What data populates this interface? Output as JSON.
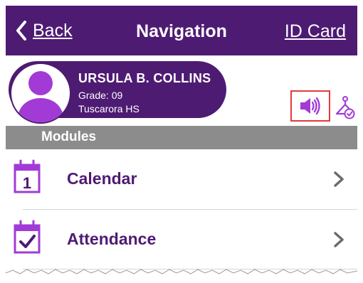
{
  "nav": {
    "back_label": "Back",
    "title": "Navigation",
    "id_card_label": "ID Card"
  },
  "student": {
    "name": "URSULA B. COLLINS",
    "grade_label": "Grade:",
    "grade_value": "09",
    "school": "Tuscarora HS"
  },
  "modules": {
    "header": "Modules",
    "items": [
      {
        "label": "Calendar",
        "icon": "calendar-icon",
        "icon_number": "1"
      },
      {
        "label": "Attendance",
        "icon": "attendance-check-icon"
      }
    ]
  },
  "colors": {
    "brand_purple": "#4e1b73",
    "accent_purple": "#a23bd6",
    "section_gray": "#8c8c8c",
    "highlight_red": "#e23a3a"
  }
}
